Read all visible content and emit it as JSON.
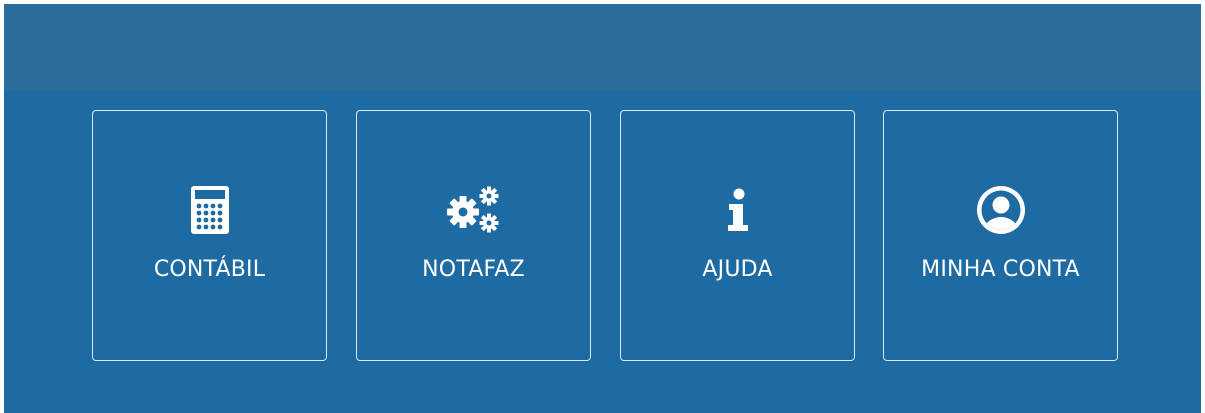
{
  "colors": {
    "background": "#1e6aa2",
    "header_band": "#2b6e9e",
    "tile_border": "#ffffff",
    "text": "#ffffff"
  },
  "tiles": [
    {
      "label": "CONTÁBIL",
      "icon": "calculator-icon"
    },
    {
      "label": "NOTAFAZ",
      "icon": "gears-icon"
    },
    {
      "label": "AJUDA",
      "icon": "info-icon"
    },
    {
      "label": "MINHA CONTA",
      "icon": "user-circle-icon"
    }
  ]
}
